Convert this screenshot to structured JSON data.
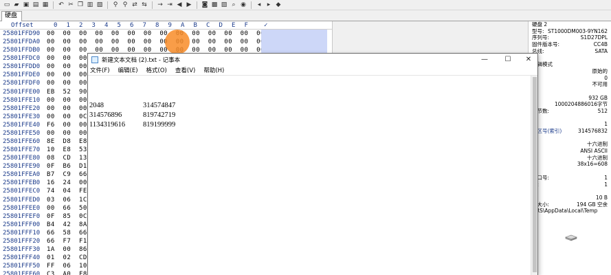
{
  "tab": {
    "label": "硬盘 2"
  },
  "toolbar": {
    "icons": [
      "new-icon",
      "open-icon",
      "save-icon",
      "print-icon",
      "properties-icon",
      "undo-icon",
      "cut-icon",
      "copy-icon",
      "paste-icon",
      "paste-special-icon",
      "find-icon",
      "find-hex-icon",
      "replace-icon",
      "replace-hex-icon",
      "goto-offset-icon",
      "goto-sector-icon",
      "back-icon",
      "forward-icon",
      "disk-icon",
      "ram-icon",
      "image-icon",
      "explore-icon",
      "analyze-icon",
      "previous-icon",
      "next-icon",
      "hint-icon"
    ]
  },
  "hex": {
    "header_offset": "Offset",
    "header_cols": [
      "0",
      "1",
      "2",
      "3",
      "4",
      "5",
      "6",
      "7",
      "8",
      "9",
      "A",
      "B",
      "C",
      "D",
      "E",
      "F"
    ],
    "rows": [
      {
        "offset": "25801FFD90",
        "bytes": "00 00 00 00 00 00 00 00 00 00 00 00 00 00 00 00"
      },
      {
        "offset": "25801FFDA0",
        "bytes": "00 00 00 00 00 00 00 00 00 00 00 00 00 00 00 00"
      },
      {
        "offset": "25801FFDB0",
        "bytes": "00 00 00 00 00 00 00 00 00 00 00 00 00 00 00 00"
      },
      {
        "offset": "25801FFDC0",
        "bytes": "00 00 00"
      },
      {
        "offset": "25801FFDD0",
        "bytes": "00 00 00"
      },
      {
        "offset": "25801FFDE0",
        "bytes": "00 00 00"
      },
      {
        "offset": "25801FFDF0",
        "bytes": "00 00 00"
      },
      {
        "offset": "25801FFE00",
        "bytes": "EB 52 90"
      },
      {
        "offset": "25801FFE10",
        "bytes": "00 00 00"
      },
      {
        "offset": "25801FFE20",
        "bytes": "00 00 00"
      },
      {
        "offset": "25801FFE30",
        "bytes": "00 00 0C"
      },
      {
        "offset": "25801FFE40",
        "bytes": "F6 00 00"
      },
      {
        "offset": "25801FFE50",
        "bytes": "00 00 00"
      },
      {
        "offset": "25801FFE60",
        "bytes": "8E D8 E8"
      },
      {
        "offset": "25801FFE70",
        "bytes": "10 E8 53"
      },
      {
        "offset": "25801FFE80",
        "bytes": "08 CD 13"
      },
      {
        "offset": "25801FFE90",
        "bytes": "0F B6 D1"
      },
      {
        "offset": "25801FFEA0",
        "bytes": "B7 C9 66"
      },
      {
        "offset": "25801FFEB0",
        "bytes": "16 24 00"
      },
      {
        "offset": "25801FFEC0",
        "bytes": "74 04 FE"
      },
      {
        "offset": "25801FFED0",
        "bytes": "03 06 1C"
      },
      {
        "offset": "25801FFEE0",
        "bytes": "00 66 50"
      },
      {
        "offset": "25801FFEF0",
        "bytes": "0F 85 0C"
      },
      {
        "offset": "25801FFF00",
        "bytes": "B4 42 8A"
      },
      {
        "offset": "25801FFF10",
        "bytes": "66 58 66"
      },
      {
        "offset": "25801FFF20",
        "bytes": "66 F7 F1"
      },
      {
        "offset": "25801FFF30",
        "bytes": "1A 00 86"
      },
      {
        "offset": "25801FFF40",
        "bytes": "01 02 CD"
      },
      {
        "offset": "25801FFF50",
        "bytes": "FF 06 10"
      },
      {
        "offset": "25801FFF60",
        "bytes": "C3 A0 F8"
      },
      {
        "offset": "25801FFF70",
        "bytes": "00 00 00"
      }
    ]
  },
  "info": {
    "rows": [
      {
        "label": "",
        "value": "",
        "full": "硬盘 2"
      },
      {
        "label": "型号:",
        "value": "ST1000DM003-9YN162"
      },
      {
        "label": "序列号:",
        "value": "S1D27DPL"
      },
      {
        "label": "固件版本号:",
        "value": "CC4B"
      },
      {
        "label": "总线:",
        "value": "SATA"
      },
      {
        "label": "",
        "value": ""
      },
      {
        "label": "",
        "value": "",
        "full": "编辑模式"
      },
      {
        "label": "",
        "value": "原始的"
      },
      {
        "label": "",
        "value": "0"
      },
      {
        "label": "",
        "value": "不可用"
      },
      {
        "label": "",
        "value": ""
      },
      {
        "label": "",
        "value": "932 GB"
      },
      {
        "label": "",
        "value": "1000204886016字节"
      },
      {
        "label": "字节数:",
        "value": "512"
      },
      {
        "label": "",
        "value": ""
      },
      {
        "label": "",
        "value": "1"
      },
      {
        "label": "扇区号(索引)",
        "value": "314576832",
        "link": true
      },
      {
        "label": "",
        "value": ""
      },
      {
        "label": "",
        "value": "十六进制"
      },
      {
        "label": "",
        "value": "ANSI ASCII"
      },
      {
        "label": "",
        "value": "十六进制"
      },
      {
        "label": "",
        "value": "38x16=608"
      },
      {
        "label": "",
        "value": ""
      },
      {
        "label": "窗口号:",
        "value": "1"
      },
      {
        "label": "数:",
        "value": "1"
      },
      {
        "label": "",
        "value": ""
      },
      {
        "label": "",
        "value": "10 B"
      },
      {
        "label": "间大小:",
        "value": "194 GB 空余"
      },
      {
        "label": "",
        "value": "",
        "full": "ORS\\AppData\\Local\\Temp"
      }
    ]
  },
  "notepad": {
    "title": "新建文本文档 (2).txt - 记事本",
    "minimize": "—",
    "maximize": "☐",
    "close": "✕",
    "menus": [
      "文件(F)",
      "编辑(E)",
      "格式(O)",
      "查看(V)",
      "帮助(H)"
    ],
    "lines": [
      {
        "c1": "2048",
        "c2": "314574847"
      },
      {
        "c1": "314576896",
        "c2": "819742719"
      },
      {
        "c1": "1134319616",
        "c2": "819199999"
      }
    ]
  },
  "colors": {
    "accent": "#1a3a8a",
    "selection": "#cdd7f8",
    "cursor": "#f88c28"
  }
}
